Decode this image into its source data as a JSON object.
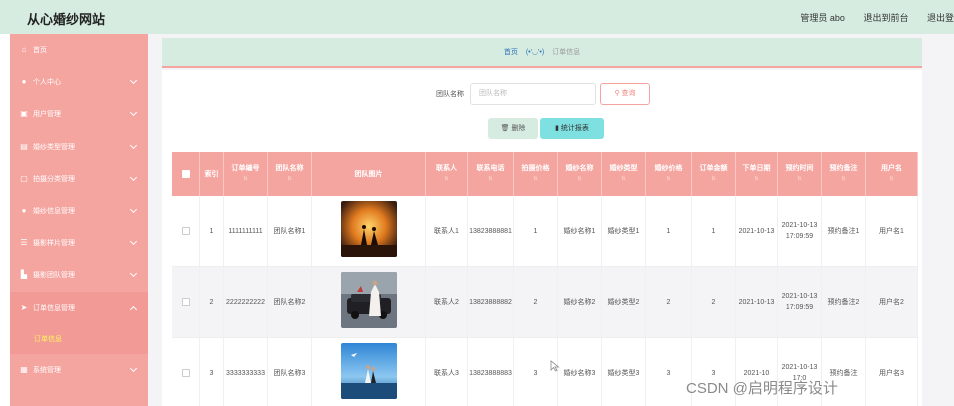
{
  "app": {
    "title": "从心婚纱网站"
  },
  "topbar": {
    "user": "管理员 abo",
    "front_link": "退出到前台",
    "logout": "退出登"
  },
  "sidebar": {
    "items": [
      {
        "label": "首页",
        "icon": "home-icon",
        "glyph": "⌂",
        "has_chevron": false
      },
      {
        "label": "个人中心",
        "icon": "user-icon",
        "glyph": "●",
        "has_chevron": true
      },
      {
        "label": "用户管理",
        "icon": "users-icon",
        "glyph": "▣",
        "has_chevron": true
      },
      {
        "label": "婚纱类型管理",
        "icon": "tag-icon",
        "glyph": "▤",
        "has_chevron": true
      },
      {
        "label": "拍摄分类管理",
        "icon": "camera-icon",
        "glyph": "▢",
        "has_chevron": true
      },
      {
        "label": "婚纱信息管理",
        "icon": "person-icon",
        "glyph": "●",
        "has_chevron": true
      },
      {
        "label": "摄影样片管理",
        "icon": "list-icon",
        "glyph": "☰",
        "has_chevron": true
      },
      {
        "label": "摄影团队管理",
        "icon": "team-icon",
        "glyph": "▙",
        "has_chevron": true
      },
      {
        "label": "订单信息管理",
        "icon": "send-icon",
        "glyph": "➤",
        "has_chevron": true,
        "expanded": true
      },
      {
        "label": "系统管理",
        "icon": "grid-icon",
        "glyph": "▦",
        "has_chevron": true
      }
    ],
    "submenu_active": "订单信息"
  },
  "breadcrumb": {
    "home": "首页",
    "face": "(•'◡'•)",
    "current": "订单信息"
  },
  "search": {
    "label": "团队名称",
    "placeholder": "团队名称",
    "button": "查询"
  },
  "actions": {
    "delete": "删除",
    "report": "统计报表"
  },
  "table": {
    "headers": [
      "",
      "索引",
      "订单编号",
      "团队名称",
      "团队图片",
      "联系人",
      "联系电话",
      "拍摄价格",
      "婚纱名称",
      "婚纱类型",
      "婚纱价格",
      "订单金额",
      "下单日期",
      "预约时间",
      "预约备注",
      "用户名"
    ],
    "rows": [
      [
        "",
        "1",
        "1111111111",
        "团队名称1",
        "",
        "联系人1",
        "13823888881",
        "1",
        "婚纱名称1",
        "婚纱类型1",
        "1",
        "1",
        "2021-10-13",
        "2021-10-13 17:09:59",
        "预约备注1",
        "用户名1"
      ],
      [
        "",
        "2",
        "2222222222",
        "团队名称2",
        "",
        "联系人2",
        "13823888882",
        "2",
        "婚纱名称2",
        "婚纱类型2",
        "2",
        "2",
        "2021-10-13",
        "2021-10-13 17:09:59",
        "预约备注2",
        "用户名2"
      ],
      [
        "",
        "3",
        "3333333333",
        "团队名称3",
        "",
        "联系人3",
        "13823888883",
        "3",
        "婚纱名称3",
        "婚纱类型3",
        "3",
        "3",
        "2021-10",
        "2021-10-13 17:0",
        "预约备注",
        "用户名3"
      ]
    ],
    "images": [
      "wedding-photo-sunset",
      "wedding-photo-car",
      "wedding-photo-beach"
    ]
  },
  "watermark": "CSDN @启明程序设计",
  "colors": {
    "sidebar": "#f5a5a0",
    "topbar": "#d6ece1",
    "accent_link": "#2a6fb4",
    "submenu_active": "#fff45c",
    "report_button": "#7ee0e0"
  }
}
